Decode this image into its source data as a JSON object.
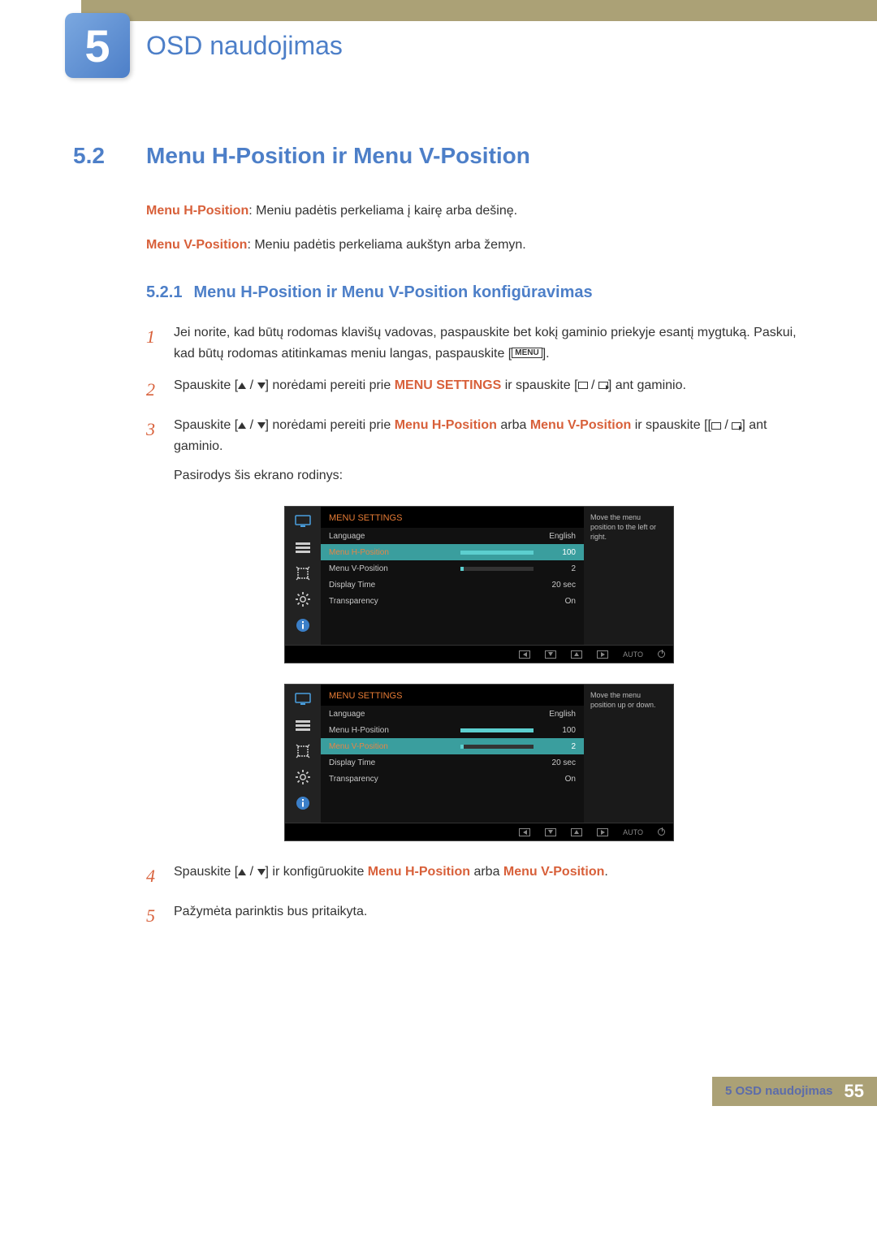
{
  "chapter": {
    "number": "5",
    "title": "OSD naudojimas"
  },
  "section": {
    "number": "5.2",
    "title": "Menu H-Position ir Menu V-Position"
  },
  "intro": {
    "h_term": "Menu H-Position",
    "h_desc": ": Meniu padėtis perkeliama į kairę arba dešinę.",
    "v_term": "Menu V-Position",
    "v_desc": ": Meniu padėtis perkeliama aukštyn arba žemyn."
  },
  "subsection": {
    "number": "5.2.1",
    "title": "Menu H-Position ir Menu V-Position konfigūravimas"
  },
  "steps": {
    "1": {
      "num": "1",
      "a": "Jei norite, kad būtų rodomas klavišų vadovas, paspauskite bet kokį gaminio priekyje esantį mygtuką. Paskui, kad būtų rodomas atitinkamas meniu langas, paspauskite [",
      "menu": "MENU",
      "b": "]."
    },
    "2": {
      "num": "2",
      "a": "Spauskite [",
      "b": "] norėdami pereiti prie ",
      "ms": "MENU SETTINGS",
      "c": " ir spauskite [",
      "d": "] ant gaminio."
    },
    "3": {
      "num": "3",
      "a": "Spauskite [",
      "b": "] norėdami pereiti prie ",
      "h": "Menu H-Position",
      "arba": " arba ",
      "v": "Menu V-Position",
      "c": " ir spauskite [[",
      "d": "] ant gaminio.",
      "e": "Pasirodys šis ekrano rodinys:"
    },
    "4": {
      "num": "4",
      "a": "Spauskite [",
      "b": "] ir konfigūruokite ",
      "h": "Menu H-Position",
      "arba": " arba ",
      "v": "Menu V-Position",
      "c": "."
    },
    "5": {
      "num": "5",
      "a": "Pažymėta parinktis bus pritaikyta."
    }
  },
  "osd_common": {
    "title": "MENU SETTINGS",
    "auto": "AUTO",
    "rows": {
      "language": {
        "label": "Language",
        "value": "English"
      },
      "hpos": {
        "label": "Menu H-Position",
        "value": "100",
        "fill": 100
      },
      "vpos": {
        "label": "Menu V-Position",
        "value": "2",
        "fill": 4
      },
      "dtime": {
        "label": "Display Time",
        "value": "20 sec"
      },
      "trans": {
        "label": "Transparency",
        "value": "On"
      }
    }
  },
  "osd1_hint": "Move the menu position to the left or right.",
  "osd2_hint": "Move the menu position up or down.",
  "footer": {
    "text": "5 OSD naudojimas",
    "page": "55"
  }
}
